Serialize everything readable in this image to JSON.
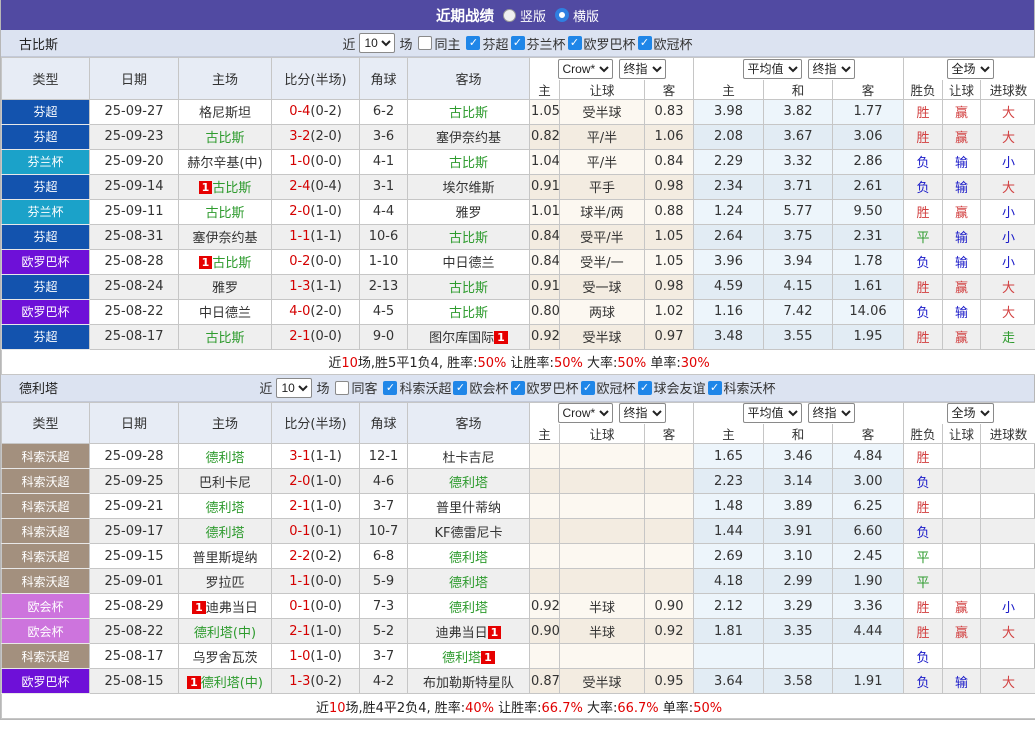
{
  "title_bar": {
    "title": "近期战绩",
    "radio_vertical": "竖版",
    "radio_horizontal": "横版",
    "selected": "横版"
  },
  "table_labels": {
    "type": "类型",
    "date": "日期",
    "home": "主场",
    "score": "比分(半场)",
    "corner": "角球",
    "away": "客场",
    "sub": [
      "主",
      "让球",
      "客",
      "主",
      "和",
      "客",
      "胜负",
      "让球",
      "进球数"
    ]
  },
  "league_colors": {
    "芬超": "#1353ae",
    "芬兰杯": "#1ba2c9",
    "欧罗巴杯": "#6e10d8",
    "科索沃超": "#a3907e",
    "欧会杯": "#cd74dd"
  },
  "status_colors": {
    "win_red": "#d24040",
    "lose_blue": "#1a1ac8",
    "draw_green": "#2e9b2e",
    "focus_team_green": "#2e9b2e",
    "badge_red": "#e60000",
    "score_red": "#d40000",
    "titlebar_purple": "#514aa2"
  },
  "sections": [
    {
      "team": "古比斯",
      "filter": {
        "near": "近",
        "count": "10",
        "games": "场",
        "same": "同主",
        "same_checked": false,
        "leagues": [
          "芬超",
          "芬兰杯",
          "欧罗巴杯",
          "欧冠杯"
        ]
      },
      "selects": {
        "odds_src": "Crow*",
        "odds_kind": "终指",
        "avg_src": "平均值",
        "avg_kind": "终指",
        "scope": "全场"
      },
      "rows": [
        {
          "league": "芬超",
          "date": "25-09-27",
          "home": {
            "name": "格尼斯坦"
          },
          "score": "0-4",
          "half": "(0-2)",
          "corners": "6-2",
          "away": {
            "name": "古比斯",
            "focus": true
          },
          "odds": [
            "1.05",
            "受半球",
            "0.83"
          ],
          "avg": [
            "3.98",
            "3.82",
            "1.77"
          ],
          "outcome": [
            [
              "胜",
              "r"
            ],
            [
              "赢",
              "r"
            ],
            [
              "大",
              "r"
            ]
          ]
        },
        {
          "league": "芬超",
          "date": "25-09-23",
          "home": {
            "name": "古比斯",
            "focus": true
          },
          "score": "3-2",
          "half": "(2-0)",
          "corners": "3-6",
          "away": {
            "name": "塞伊奈约基"
          },
          "odds": [
            "0.82",
            "平/半",
            "1.06"
          ],
          "avg": [
            "2.08",
            "3.67",
            "3.06"
          ],
          "outcome": [
            [
              "胜",
              "r"
            ],
            [
              "赢",
              "r"
            ],
            [
              "大",
              "r"
            ]
          ]
        },
        {
          "league": "芬兰杯",
          "date": "25-09-20",
          "home": {
            "name": "赫尔辛基(中)"
          },
          "score": "1-0",
          "half": "(0-0)",
          "corners": "4-1",
          "away": {
            "name": "古比斯",
            "focus": true
          },
          "odds": [
            "1.04",
            "平/半",
            "0.84"
          ],
          "avg": [
            "2.29",
            "3.32",
            "2.86"
          ],
          "outcome": [
            [
              "负",
              "b"
            ],
            [
              "输",
              "b"
            ],
            [
              "小",
              "b"
            ]
          ]
        },
        {
          "league": "芬超",
          "date": "25-09-14",
          "home": {
            "name": "古比斯",
            "focus": true,
            "badge": "pre"
          },
          "score": "2-4",
          "half": "(0-4)",
          "corners": "3-1",
          "away": {
            "name": "埃尔维斯"
          },
          "odds": [
            "0.91",
            "平手",
            "0.98"
          ],
          "avg": [
            "2.34",
            "3.71",
            "2.61"
          ],
          "outcome": [
            [
              "负",
              "b"
            ],
            [
              "输",
              "b"
            ],
            [
              "大",
              "r"
            ]
          ]
        },
        {
          "league": "芬兰杯",
          "date": "25-09-11",
          "home": {
            "name": "古比斯",
            "focus": true
          },
          "score": "2-0",
          "half": "(1-0)",
          "corners": "4-4",
          "away": {
            "name": "雅罗"
          },
          "odds": [
            "1.01",
            "球半/两",
            "0.88"
          ],
          "avg": [
            "1.24",
            "5.77",
            "9.50"
          ],
          "outcome": [
            [
              "胜",
              "r"
            ],
            [
              "赢",
              "r"
            ],
            [
              "小",
              "b"
            ]
          ]
        },
        {
          "league": "芬超",
          "date": "25-08-31",
          "home": {
            "name": "塞伊奈约基"
          },
          "score": "1-1",
          "half": "(1-1)",
          "corners": "10-6",
          "away": {
            "name": "古比斯",
            "focus": true
          },
          "odds": [
            "0.84",
            "受平/半",
            "1.05"
          ],
          "avg": [
            "2.64",
            "3.75",
            "2.31"
          ],
          "outcome": [
            [
              "平",
              "g"
            ],
            [
              "输",
              "b"
            ],
            [
              "小",
              "b"
            ]
          ]
        },
        {
          "league": "欧罗巴杯",
          "date": "25-08-28",
          "home": {
            "name": "古比斯",
            "focus": true,
            "badge": "pre"
          },
          "score": "0-2",
          "half": "(0-0)",
          "corners": "1-10",
          "away": {
            "name": "中日德兰"
          },
          "odds": [
            "0.84",
            "受半/一",
            "1.05"
          ],
          "avg": [
            "3.96",
            "3.94",
            "1.78"
          ],
          "outcome": [
            [
              "负",
              "b"
            ],
            [
              "输",
              "b"
            ],
            [
              "小",
              "b"
            ]
          ]
        },
        {
          "league": "芬超",
          "date": "25-08-24",
          "home": {
            "name": "雅罗"
          },
          "score": "1-3",
          "half": "(1-1)",
          "corners": "2-13",
          "away": {
            "name": "古比斯",
            "focus": true
          },
          "odds": [
            "0.91",
            "受一球",
            "0.98"
          ],
          "avg": [
            "4.59",
            "4.15",
            "1.61"
          ],
          "outcome": [
            [
              "胜",
              "r"
            ],
            [
              "赢",
              "r"
            ],
            [
              "大",
              "r"
            ]
          ]
        },
        {
          "league": "欧罗巴杯",
          "date": "25-08-22",
          "home": {
            "name": "中日德兰"
          },
          "score": "4-0",
          "half": "(2-0)",
          "corners": "4-5",
          "away": {
            "name": "古比斯",
            "focus": true
          },
          "odds": [
            "0.80",
            "两球",
            "1.02"
          ],
          "avg": [
            "1.16",
            "7.42",
            "14.06"
          ],
          "outcome": [
            [
              "负",
              "b"
            ],
            [
              "输",
              "b"
            ],
            [
              "大",
              "r"
            ]
          ]
        },
        {
          "league": "芬超",
          "date": "25-08-17",
          "home": {
            "name": "古比斯",
            "focus": true
          },
          "score": "2-1",
          "half": "(0-0)",
          "corners": "9-0",
          "away": {
            "name": "图尔库国际",
            "badge": "post"
          },
          "odds": [
            "0.92",
            "受半球",
            "0.97"
          ],
          "avg": [
            "3.48",
            "3.55",
            "1.95"
          ],
          "outcome": [
            [
              "胜",
              "r"
            ],
            [
              "赢",
              "r"
            ],
            [
              "走",
              "g"
            ]
          ]
        }
      ],
      "summary": [
        [
          "近",
          0
        ],
        [
          "10",
          1
        ],
        [
          "场,胜5平1负4, 胜率:",
          0
        ],
        [
          "50%",
          1
        ],
        [
          " 让胜率:",
          0
        ],
        [
          "50%",
          1
        ],
        [
          " 大率:",
          0
        ],
        [
          "50%",
          1
        ],
        [
          " 单率:",
          0
        ],
        [
          "30%",
          1
        ]
      ]
    },
    {
      "team": "德利塔",
      "filter": {
        "near": "近",
        "count": "10",
        "games": "场",
        "same": "同客",
        "same_checked": false,
        "leagues": [
          "科索沃超",
          "欧会杯",
          "欧罗巴杯",
          "欧冠杯",
          "球会友谊",
          "科索沃杯"
        ]
      },
      "selects": {
        "odds_src": "Crow*",
        "odds_kind": "终指",
        "avg_src": "平均值",
        "avg_kind": "终指",
        "scope": "全场"
      },
      "rows": [
        {
          "league": "科索沃超",
          "date": "25-09-28",
          "home": {
            "name": "德利塔",
            "focus": true
          },
          "score": "3-1",
          "half": "(1-1)",
          "corners": "12-1",
          "away": {
            "name": "杜卡吉尼"
          },
          "odds": [
            "",
            "",
            ""
          ],
          "avg": [
            "1.65",
            "3.46",
            "4.84"
          ],
          "outcome": [
            [
              "胜",
              "r"
            ],
            [
              "",
              ""
            ],
            [
              "",
              ""
            ]
          ]
        },
        {
          "league": "科索沃超",
          "date": "25-09-25",
          "home": {
            "name": "巴利卡尼"
          },
          "score": "2-0",
          "half": "(1-0)",
          "corners": "4-6",
          "away": {
            "name": "德利塔",
            "focus": true
          },
          "odds": [
            "",
            "",
            ""
          ],
          "avg": [
            "2.23",
            "3.14",
            "3.00"
          ],
          "outcome": [
            [
              "负",
              "b"
            ],
            [
              "",
              ""
            ],
            [
              "",
              ""
            ]
          ]
        },
        {
          "league": "科索沃超",
          "date": "25-09-21",
          "home": {
            "name": "德利塔",
            "focus": true
          },
          "score": "2-1",
          "half": "(1-0)",
          "corners": "3-7",
          "away": {
            "name": "普里什蒂纳"
          },
          "odds": [
            "",
            "",
            ""
          ],
          "avg": [
            "1.48",
            "3.89",
            "6.25"
          ],
          "outcome": [
            [
              "胜",
              "r"
            ],
            [
              "",
              ""
            ],
            [
              "",
              ""
            ]
          ]
        },
        {
          "league": "科索沃超",
          "date": "25-09-17",
          "home": {
            "name": "德利塔",
            "focus": true
          },
          "score": "0-1",
          "half": "(0-1)",
          "corners": "10-7",
          "away": {
            "name": "KF德雷尼卡"
          },
          "odds": [
            "",
            "",
            ""
          ],
          "avg": [
            "1.44",
            "3.91",
            "6.60"
          ],
          "outcome": [
            [
              "负",
              "b"
            ],
            [
              "",
              ""
            ],
            [
              "",
              ""
            ]
          ]
        },
        {
          "league": "科索沃超",
          "date": "25-09-15",
          "home": {
            "name": "普里斯堤纳"
          },
          "score": "2-2",
          "half": "(0-2)",
          "corners": "6-8",
          "away": {
            "name": "德利塔",
            "focus": true
          },
          "odds": [
            "",
            "",
            ""
          ],
          "avg": [
            "2.69",
            "3.10",
            "2.45"
          ],
          "outcome": [
            [
              "平",
              "g"
            ],
            [
              "",
              ""
            ],
            [
              "",
              ""
            ]
          ]
        },
        {
          "league": "科索沃超",
          "date": "25-09-01",
          "home": {
            "name": "罗拉匹"
          },
          "score": "1-1",
          "half": "(0-0)",
          "corners": "5-9",
          "away": {
            "name": "德利塔",
            "focus": true
          },
          "odds": [
            "",
            "",
            ""
          ],
          "avg": [
            "4.18",
            "2.99",
            "1.90"
          ],
          "outcome": [
            [
              "平",
              "g"
            ],
            [
              "",
              ""
            ],
            [
              "",
              ""
            ]
          ]
        },
        {
          "league": "欧会杯",
          "date": "25-08-29",
          "home": {
            "name": "迪弗当日",
            "badge": "pre"
          },
          "score": "0-1",
          "half": "(0-0)",
          "corners": "7-3",
          "away": {
            "name": "德利塔",
            "focus": true
          },
          "odds": [
            "0.92",
            "半球",
            "0.90"
          ],
          "avg": [
            "2.12",
            "3.29",
            "3.36"
          ],
          "outcome": [
            [
              "胜",
              "r"
            ],
            [
              "赢",
              "r"
            ],
            [
              "小",
              "b"
            ]
          ]
        },
        {
          "league": "欧会杯",
          "date": "25-08-22",
          "home": {
            "name": "德利塔(中)",
            "focus": true
          },
          "score": "2-1",
          "half": "(1-0)",
          "corners": "5-2",
          "away": {
            "name": "迪弗当日",
            "badge": "post"
          },
          "odds": [
            "0.90",
            "半球",
            "0.92"
          ],
          "avg": [
            "1.81",
            "3.35",
            "4.44"
          ],
          "outcome": [
            [
              "胜",
              "r"
            ],
            [
              "赢",
              "r"
            ],
            [
              "大",
              "r"
            ]
          ]
        },
        {
          "league": "科索沃超",
          "date": "25-08-17",
          "home": {
            "name": "乌罗舍瓦茨"
          },
          "score": "1-0",
          "half": "(1-0)",
          "corners": "3-7",
          "away": {
            "name": "德利塔",
            "focus": true,
            "badge": "post"
          },
          "odds": [
            "",
            "",
            ""
          ],
          "avg": [
            "",
            "",
            ""
          ],
          "outcome": [
            [
              "负",
              "b"
            ],
            [
              "",
              ""
            ],
            [
              "",
              ""
            ]
          ]
        },
        {
          "league": "欧罗巴杯",
          "date": "25-08-15",
          "home": {
            "name": "德利塔(中)",
            "focus": true,
            "badge": "pre"
          },
          "score": "1-3",
          "half": "(0-2)",
          "corners": "4-2",
          "away": {
            "name": "布加勒斯特星队"
          },
          "odds": [
            "0.87",
            "受半球",
            "0.95"
          ],
          "avg": [
            "3.64",
            "3.58",
            "1.91"
          ],
          "outcome": [
            [
              "负",
              "b"
            ],
            [
              "输",
              "b"
            ],
            [
              "大",
              "r"
            ]
          ]
        }
      ],
      "summary": [
        [
          "近",
          0
        ],
        [
          "10",
          1
        ],
        [
          "场,胜4平2负4, 胜率:",
          0
        ],
        [
          "40%",
          1
        ],
        [
          " 让胜率:",
          0
        ],
        [
          "66.7%",
          1
        ],
        [
          " 大率:",
          0
        ],
        [
          "66.7%",
          1
        ],
        [
          " 单率:",
          0
        ],
        [
          "50%",
          1
        ]
      ]
    }
  ]
}
